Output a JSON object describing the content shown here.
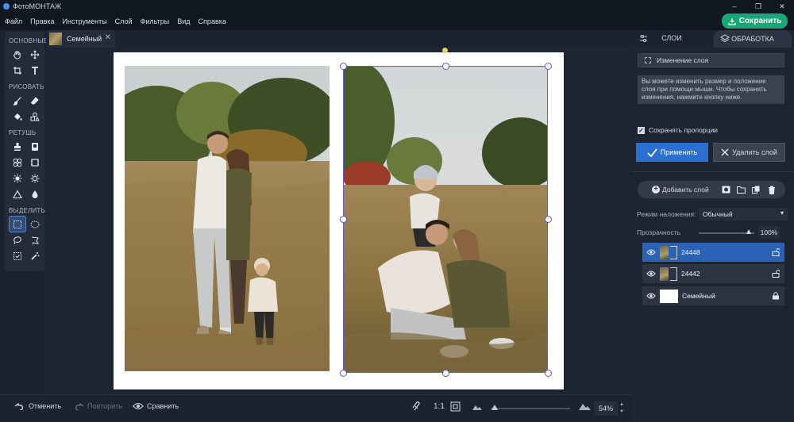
{
  "app": {
    "title": "ФотоМОНТАЖ"
  },
  "window_controls": {
    "minimize": "–",
    "maximize": "❐",
    "close": "✕"
  },
  "menu": [
    "Файл",
    "Правка",
    "Инструменты",
    "Слой",
    "Фильтры",
    "Вид",
    "Справка"
  ],
  "save_label": "Сохранить",
  "toolbar": {
    "groups": [
      {
        "label": "ОСНОВНЫЕ",
        "tools": [
          "hand-icon",
          "move-icon",
          "crop-icon",
          "text-icon"
        ]
      },
      {
        "label": "РИСОВАТЬ",
        "tools": [
          "brush-icon",
          "eraser-icon",
          "fill-icon",
          "shapes-icon"
        ]
      },
      {
        "label": "РЕТУШЬ",
        "tools": [
          "stamp-icon",
          "patch-icon",
          "heal-icon",
          "frame-icon",
          "brightness-icon",
          "exposure-icon",
          "sharpen-icon",
          "drop-icon"
        ]
      },
      {
        "label": "ВЫДЕЛИТЬ",
        "tools": [
          "rect-select-icon",
          "ellipse-select-icon",
          "lasso-icon",
          "poly-lasso-icon",
          "select-all-icon",
          "magic-wand-icon"
        ]
      }
    ]
  },
  "doc_tab": {
    "name": "Семейный",
    "close": "✕"
  },
  "bottom": {
    "undo": "Отменить",
    "redo": "Повторить",
    "compare": "Сравнить",
    "ratio": "1:1",
    "zoom": "54%",
    "zoom_fraction": 0.05
  },
  "panel": {
    "tab_layers": "СЛОИ",
    "tab_processing": "ОБРАБОТКА",
    "edit_layer": "Изменение слоя",
    "info": "Вы можете изменить размер и положение слоя при помощи мыши. Чтобы сохранить изменения, нажмите кнопку ниже.",
    "keep_proportions": "Сохранять пропорции",
    "keep_checked": true,
    "apply": "Применить",
    "delete": "Удалить слой",
    "add_layer": "Добавить слой",
    "blend_label": "Режим наложения:",
    "blend_value": "Обычный",
    "opacity_label": "Прозрачность",
    "opacity_value": "100%",
    "opacity_fraction": 1.0,
    "layers": [
      {
        "name": "24448",
        "selected": true
      },
      {
        "name": "24442",
        "selected": false
      },
      {
        "name": "Семейный",
        "selected": false
      }
    ]
  },
  "colors": {
    "accent": "#2a70d3",
    "save": "#18a877",
    "selection": "#6a5ccb"
  }
}
